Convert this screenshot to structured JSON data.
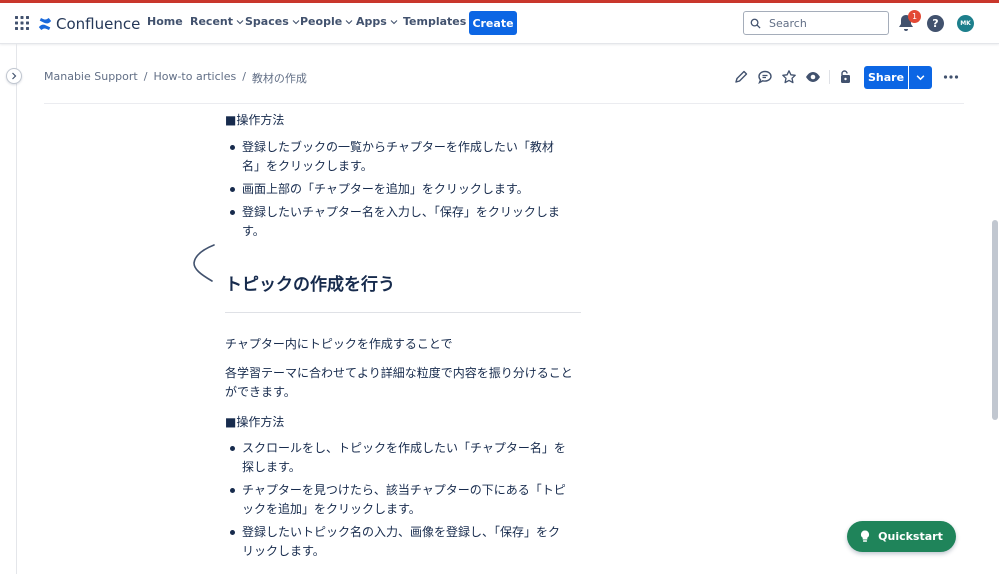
{
  "nav": {
    "logo": "Confluence",
    "items": [
      {
        "label": "Home",
        "dropdown": false
      },
      {
        "label": "Recent",
        "dropdown": true
      },
      {
        "label": "Spaces",
        "dropdown": true
      },
      {
        "label": "People",
        "dropdown": true
      },
      {
        "label": "Apps",
        "dropdown": true
      },
      {
        "label": "Templates",
        "dropdown": false
      }
    ],
    "create_label": "Create",
    "search_placeholder": "Search",
    "notification_count": "1",
    "help_label": "?",
    "avatar_initials": "MK"
  },
  "breadcrumb": {
    "items": [
      "Manabie Support",
      "How-to articles",
      "教材の作成"
    ],
    "separator": "/"
  },
  "actions": {
    "share_label": "Share"
  },
  "content": {
    "section1_label": "■操作方法",
    "section1_steps": [
      "登録したブックの一覧からチャプターを作成したい「教材名」をクリックします。",
      "画面上部の「チャプターを追加」をクリックします。",
      "登録したいチャプター名を入力し、「保存」をクリックします。"
    ],
    "heading": "トピックの作成を行う",
    "para1": "チャプター内にトピックを作成することで",
    "para2": "各学習テーマに合わせてより詳細な粒度で内容を振り分けることができます。",
    "section2_label": "■操作方法",
    "section2_steps": [
      "スクロールをし、トピックを作成したい「チャプター名」を探します。",
      "チャプターを見つけたら、該当チャプターの下にある「トピックを追加」をクリックします。",
      "登録したいトピック名の入力、画像を登録し、「保存」をクリックします。"
    ]
  },
  "quickstart_label": "Quickstart",
  "colors": {
    "primary": "#0c66e4",
    "quickstart": "#1f845a",
    "badge": "#e34935",
    "avatar": "#1d7f8c",
    "text": "#172b4d"
  }
}
